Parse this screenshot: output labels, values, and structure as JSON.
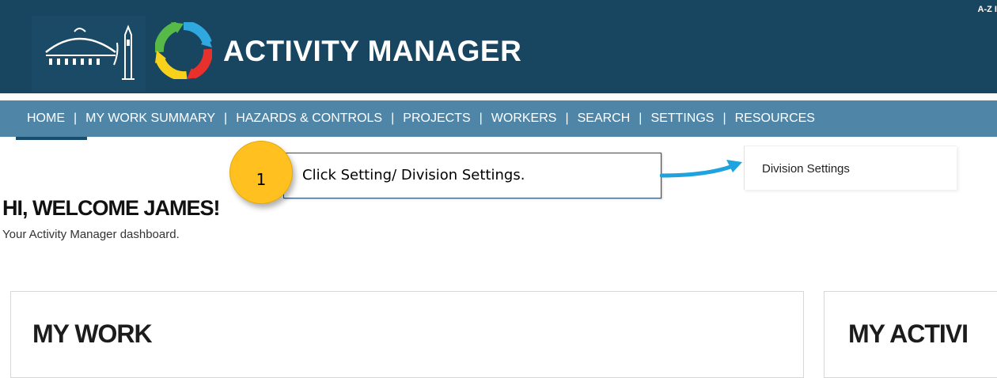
{
  "header": {
    "app_title": "ACTIVITY MANAGER",
    "az_link": "A-Z I"
  },
  "nav": {
    "items": [
      "HOME",
      "MY WORK SUMMARY",
      "HAZARDS & CONTROLS",
      "PROJECTS",
      "WORKERS",
      "SEARCH",
      "SETTINGS",
      "RESOURCES"
    ],
    "separator": "|",
    "active": "HOME"
  },
  "dropdown": {
    "items": [
      "Division Settings"
    ]
  },
  "main": {
    "welcome": "HI, WELCOME JAMES!",
    "subtitle": "Your Activity Manager dashboard."
  },
  "cards": {
    "left_title": "MY WORK",
    "right_title": "MY ACTIVI"
  },
  "annotation": {
    "step_number": "1",
    "text": "Click Setting/ Division Settings."
  },
  "colors": {
    "header_bg": "#184560",
    "nav_bg": "#4f86a8",
    "badge": "#ffc020",
    "arrow": "#1ea3de"
  }
}
